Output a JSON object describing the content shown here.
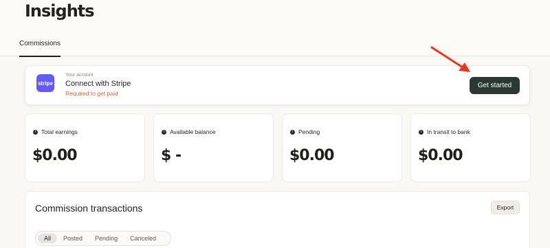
{
  "page": {
    "title": "Insights"
  },
  "tabs": [
    {
      "label": "Commissions",
      "active": true
    }
  ],
  "stripe": {
    "logo_text": "stripe",
    "caption": "Your account",
    "title": "Connect with Stripe",
    "note": "Required to get paid",
    "button_label": "Get started"
  },
  "stats": [
    {
      "label": "Total earnings",
      "value": "$0.00"
    },
    {
      "label": "Available balance",
      "value": "$ -"
    },
    {
      "label": "Pending",
      "value": "$0.00"
    },
    {
      "label": "In transit to bank",
      "value": "$0.00"
    }
  ],
  "transactions": {
    "title": "Commission transactions",
    "export_label": "Export",
    "filters": [
      "All",
      "Posted",
      "Pending",
      "Canceled"
    ],
    "active_filter": "All"
  },
  "colors": {
    "background": "#f9f8f4",
    "primary_button": "#2a3a33",
    "stripe_brand": "#635bff",
    "warning_text": "#d1673f",
    "annotation_arrow": "#e8371e"
  },
  "icons": {
    "info": "info-icon",
    "annotation": "red-arrow-icon"
  }
}
